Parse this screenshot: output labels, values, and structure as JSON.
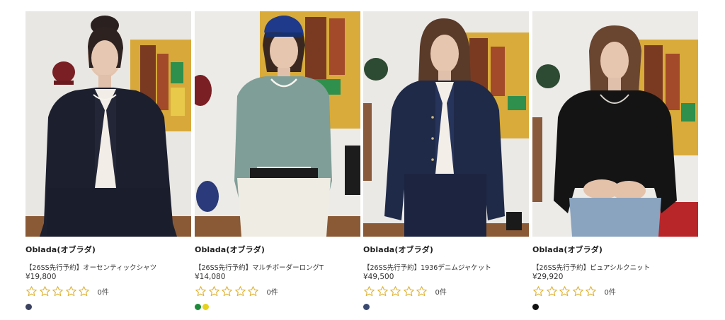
{
  "products": [
    {
      "brand": "Oblada(オブラダ)",
      "name": "【26SS先行予約】オーセンティックシャツ",
      "price": "¥19,800",
      "review_count": "0件",
      "rating": 0,
      "swatches": [
        "#3b4260"
      ]
    },
    {
      "brand": "Oblada(オブラダ)",
      "name": "【26SS先行予約】マルチボーダーロングT",
      "price": "¥14,080",
      "review_count": "0件",
      "rating": 0,
      "swatches": [
        "#1d8a3a",
        "#e6d21a"
      ]
    },
    {
      "brand": "Oblada(オブラダ)",
      "name": "【26SS先行予約】1936デニムジャケット",
      "price": "¥49,500",
      "review_count": "0件",
      "rating": 0,
      "swatches": [
        "#3b4a70"
      ]
    },
    {
      "brand": "Oblada(オブラダ)",
      "name": "【26SS先行予約】ピュアシルクニット",
      "price": "¥29,920",
      "review_count": "0件",
      "rating": 0,
      "swatches": [
        "#111111"
      ]
    }
  ],
  "colors": {
    "star_outline": "#e0b43a",
    "text": "#222222"
  }
}
